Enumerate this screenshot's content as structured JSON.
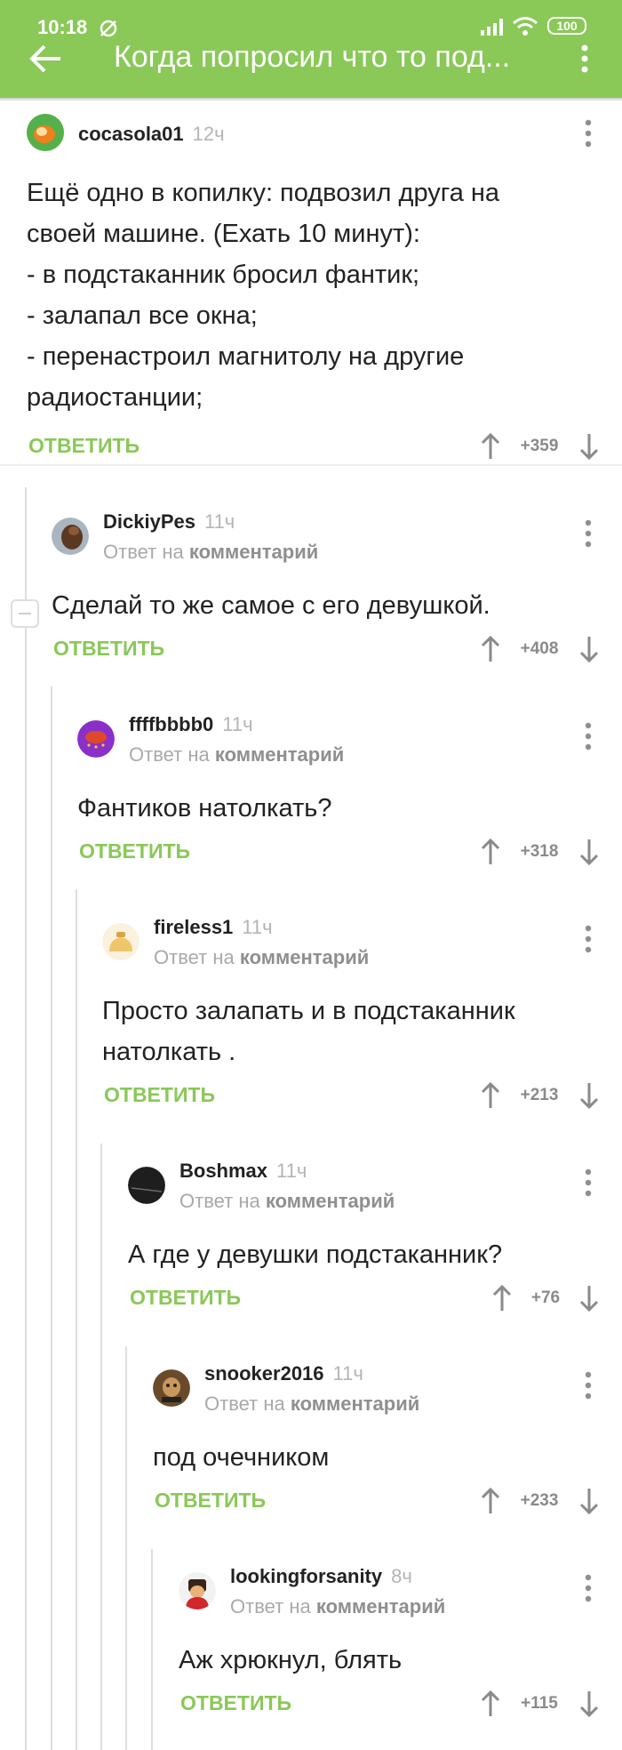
{
  "status_bar": {
    "time": "10:18",
    "battery": "100"
  },
  "header": {
    "title": "Когда попросил что то под..."
  },
  "reply_to_text": "Ответ на",
  "reply_to_link": "комментарий",
  "reply_label": "ОТВЕТИТЬ",
  "comments": [
    {
      "author": "cocasola01",
      "time": "12ч",
      "text": "Ещё одно в копилку: подвозил друга на\nсвоей машине. (Ехать 10 минут):\n- в подстаканник бросил фантик;\n- залапал все окна;\n- перенастроил магнитолу на другие\nрадиостанции;",
      "score": "+359"
    },
    {
      "author": "DickiyPes",
      "time": "11ч",
      "text": "Сделай то же самое с его девушкой.",
      "score": "+408"
    },
    {
      "author": "ffffbbbb0",
      "time": "11ч",
      "text": "Фантиков натолкать?",
      "score": "+318"
    },
    {
      "author": "fireless1",
      "time": "11ч",
      "text": "Просто залапать и в подстаканник\nнатолкать .",
      "score": "+213"
    },
    {
      "author": "Boshmax",
      "time": "11ч",
      "text": "А где у девушки подстаканник?",
      "score": "+76"
    },
    {
      "author": "snooker2016",
      "time": "11ч",
      "text": "под очечником",
      "score": "+233"
    },
    {
      "author": "lookingforsanity",
      "time": "8ч",
      "text": "Аж хрюкнул, блять",
      "score": "+115"
    }
  ],
  "colors": {
    "accent": "#8ac858",
    "muted": "#b5b5b5",
    "text": "#222222"
  },
  "icons": [
    "back-arrow-icon",
    "kebab-menu-icon",
    "upvote-arrow-icon",
    "downvote-arrow-icon",
    "collapse-thread-icon"
  ]
}
